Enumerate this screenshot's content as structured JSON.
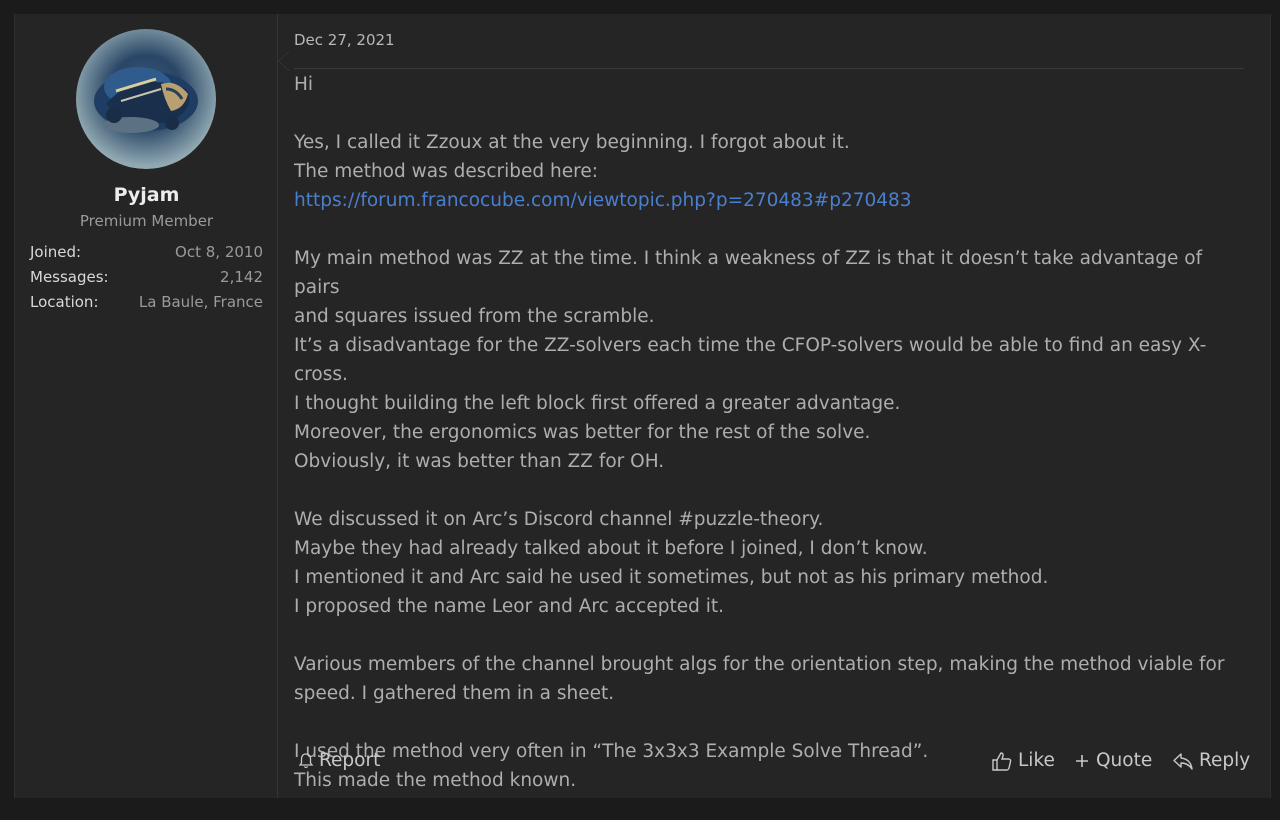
{
  "post": {
    "date": "Dec 27, 2021",
    "user": {
      "name": "Pyjam",
      "title": "Premium Member",
      "stats": [
        {
          "label": "Joined:",
          "value": "Oct 8, 2010"
        },
        {
          "label": "Messages:",
          "value": "2,142"
        },
        {
          "label": "Location:",
          "value": "La Baule, France"
        }
      ]
    },
    "body": {
      "greeting": "Hi",
      "p1_line1": "Yes, I called it Zzoux at the very beginning. I forgot about it.",
      "p1_line2": "The method was described here:",
      "p1_link": "https://forum.francocube.com/viewtopic.php?p=270483#p270483",
      "p2_line1": "My main method was ZZ at the time. I think a weakness of ZZ is that it doesn’t take advantage of pairs",
      "p2_line2": "and squares issued from the scramble.",
      "p2_line3": "It’s a disadvantage for the ZZ-solvers each time the CFOP-solvers would be able to find an easy X-cross.",
      "p2_line4": "I thought building the left block first offered a greater advantage.",
      "p2_line5": "Moreover, the ergonomics was better for the rest of the solve.",
      "p2_line6": "Obviously, it was better than ZZ for OH.",
      "p3_line1": "We discussed it on Arc’s Discord channel #puzzle-theory.",
      "p3_line2": "Maybe they had already talked about it before I joined, I don’t know.",
      "p3_line3": "I mentioned it and Arc said he used it sometimes, but not as his primary method.",
      "p3_line4": "I proposed the name Leor and Arc accepted it.",
      "p4_line1": "Various members of the channel brought algs for the orientation step, making the method viable for",
      "p4_line2": "speed. I gathered them in a sheet.",
      "p5_line1": "I used the method very often in “The 3x3x3 Example Solve Thread”.",
      "p5_line2": "This made the method known."
    },
    "actions": {
      "report": "Report",
      "like": "Like",
      "quote": "Quote",
      "reply": "Reply"
    }
  },
  "colors": {
    "background": "#1b1b1b",
    "panel": "#252526",
    "link": "#4a7fcf",
    "text": "#aeaeae"
  }
}
